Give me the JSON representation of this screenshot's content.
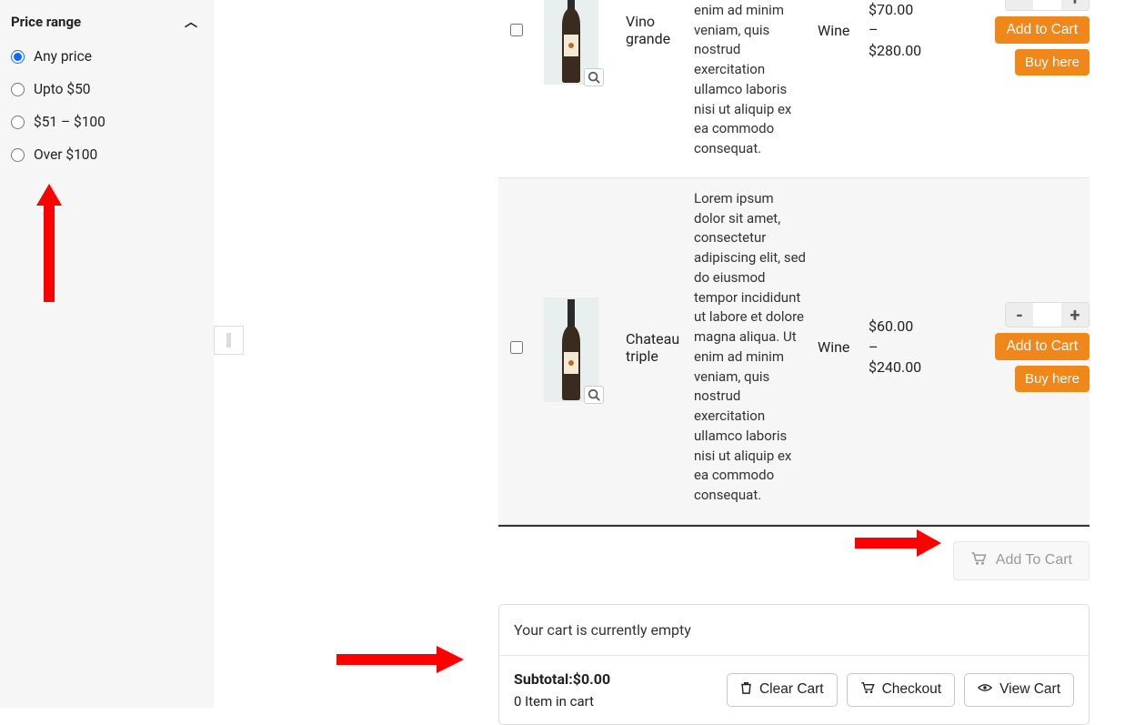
{
  "sidebar": {
    "filter_title": "Price range",
    "options": [
      {
        "label": "Any price",
        "checked": true
      },
      {
        "label": "Upto $50",
        "checked": false
      },
      {
        "label": "$51 – $100",
        "checked": false
      },
      {
        "label": "Over $100",
        "checked": false
      }
    ]
  },
  "products": [
    {
      "name": "Vino grande",
      "description": "adipiscing elit, sed do eiusmod tempor incididunt ut labore et dolore magna aliqua. Ut enim ad minim veniam, quis nostrud exercitation ullamco laboris nisi ut aliquip ex ea commodo consequat.",
      "category": "Wine",
      "price_low": "$70.00",
      "price_sep": "–",
      "price_high": "$280.00",
      "minus": "-",
      "plus": "+",
      "add_label": "Add to Cart",
      "buy_label": "Buy here"
    },
    {
      "name": "Chateau triple",
      "description": "Lorem ipsum dolor sit amet, consectetur adipiscing elit, sed do eiusmod tempor incididunt ut labore et dolore magna aliqua. Ut enim ad minim veniam, quis nostrud exercitation ullamco laboris nisi ut aliquip ex ea commodo consequat.",
      "category": "Wine",
      "price_low": "$60.00",
      "price_sep": "–",
      "price_high": "$240.00",
      "minus": "-",
      "plus": "+",
      "add_label": "Add to Cart",
      "buy_label": "Buy here"
    }
  ],
  "bulk_add_label": "Add To Cart",
  "cart": {
    "empty_text": "Your cart is currently empty",
    "subtotal_label": "Subtotal:",
    "subtotal_value": "$0.00",
    "items_text": "0 Item in cart",
    "clear_label": "Clear Cart",
    "checkout_label": "Checkout",
    "view_label": "View Cart"
  }
}
